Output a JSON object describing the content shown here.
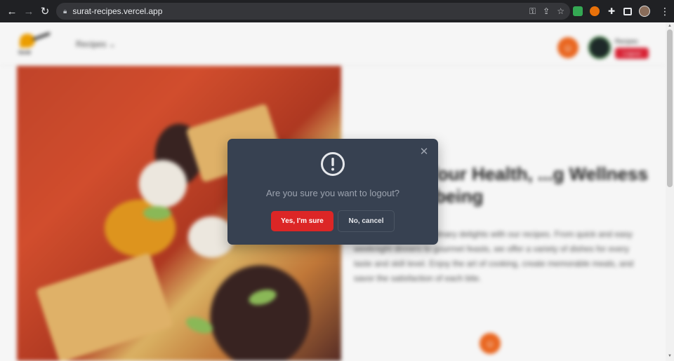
{
  "browser": {
    "url": "surat-recipes.vercel.app",
    "icons": [
      "back-icon",
      "forward-icon",
      "reload-icon",
      "lock-icon",
      "key-icon",
      "share-icon",
      "star-icon",
      "extension-icon",
      "puzzle-icon",
      "side-panel-icon",
      "profile-avatar",
      "menu-icon"
    ]
  },
  "site": {
    "logo_text": "Surat",
    "nav_recipes": "Recipes",
    "user_name": "Recipes",
    "logout_label": "Logout",
    "hero_title": "...About Your Health, ...g Wellness and Well-being",
    "hero_description": "Discover a world of culinary delights with our recipes. From quick and easy weeknight dinners to gourmet feasts, we offer a variety of dishes for every taste and skill level. Enjoy the art of cooking, create memorable meals, and savor the satisfaction of each bite."
  },
  "modal": {
    "message": "Are you sure you want to logout?",
    "confirm_label": "Yes, I'm sure",
    "cancel_label": "No, cancel",
    "close_symbol": "✕"
  },
  "colors": {
    "modal_bg": "#374151",
    "confirm_bg": "#dc2626",
    "accent_orange": "#f26a21"
  }
}
